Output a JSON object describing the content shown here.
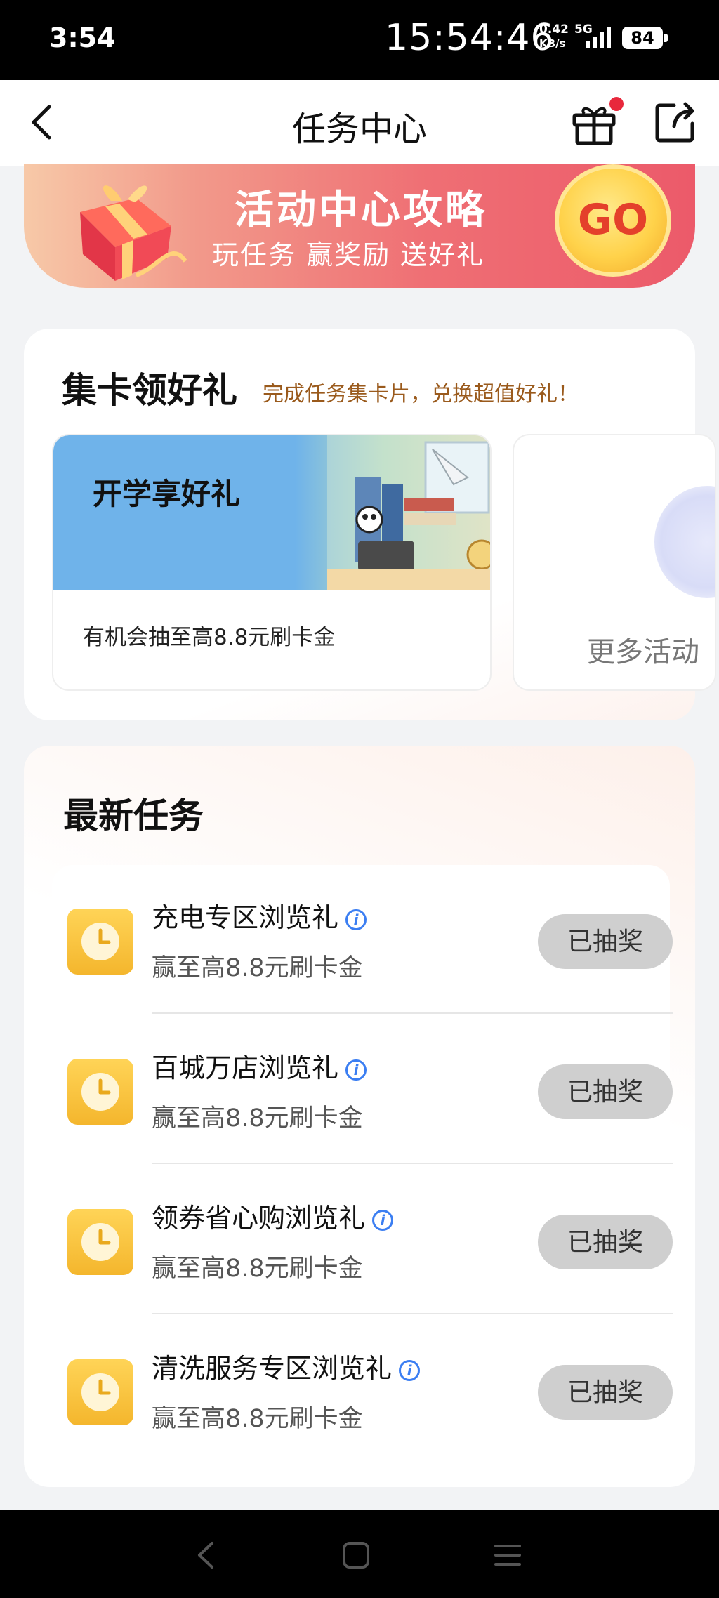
{
  "status_bar": {
    "time_left": "3:54",
    "clock": "15:54:46",
    "net_speed": "0.42",
    "net_unit": "KB/s",
    "network_type": "5G",
    "battery": "84"
  },
  "nav": {
    "title": "任务中心",
    "back_icon": "chevron-left-icon",
    "gift_icon": "gift-icon",
    "share_icon": "share-icon",
    "has_notification_dot": true
  },
  "banner": {
    "title": "活动中心攻略",
    "subtitle": "玩任务 赢奖励 送好礼",
    "go_label": "GO"
  },
  "card_collect": {
    "title": "集卡领好礼",
    "description": "完成任务集卡片，兑换超值好礼！",
    "activities": [
      {
        "title": "开学享好礼",
        "description": "有机会抽至高8.8元刷卡金"
      },
      {
        "title": "更多活动"
      }
    ]
  },
  "latest_tasks": {
    "title": "最新任务",
    "tasks": [
      {
        "name": "充电专区浏览礼",
        "reward": "赢至高8.8元刷卡金",
        "button": "已抽奖"
      },
      {
        "name": "百城万店浏览礼",
        "reward": "赢至高8.8元刷卡金",
        "button": "已抽奖"
      },
      {
        "name": "领券省心购浏览礼",
        "reward": "赢至高8.8元刷卡金",
        "button": "已抽奖"
      },
      {
        "name": "清洗服务专区浏览礼",
        "reward": "赢至高8.8元刷卡金",
        "button": "已抽奖"
      }
    ]
  },
  "colors": {
    "banner_start": "#f7c9a8",
    "banner_end": "#ec5a6a",
    "go_button": "#ffd24a",
    "task_icon": "#f4b62d",
    "info_icon": "#3b7ef2",
    "disabled_button": "#cfcfcf",
    "notification_dot": "#e8283c"
  }
}
